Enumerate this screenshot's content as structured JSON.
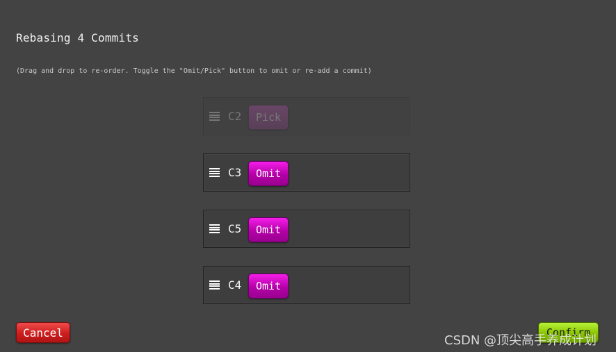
{
  "dialog": {
    "title": "Rebasing 4 Commits",
    "hint": "(Drag and drop to re-order. Toggle the \"Omit/Pick\" button to omit or re-add a commit)"
  },
  "commits": [
    {
      "id": "C2",
      "toggle_label": "Pick",
      "omitted": true
    },
    {
      "id": "C3",
      "toggle_label": "Omit",
      "omitted": false
    },
    {
      "id": "C5",
      "toggle_label": "Omit",
      "omitted": false
    },
    {
      "id": "C4",
      "toggle_label": "Omit",
      "omitted": false
    }
  ],
  "footer": {
    "cancel_label": "Cancel",
    "confirm_label": "Confirm"
  },
  "watermark": {
    "text": "CSDN @顶尖高手养成计划"
  },
  "colors": {
    "background": "#434343",
    "omit_button": "#d10bc4",
    "cancel_button": "#d92525",
    "confirm_button": "#96d40a"
  },
  "icons": {
    "drag_handle": "drag-handle-icon"
  }
}
